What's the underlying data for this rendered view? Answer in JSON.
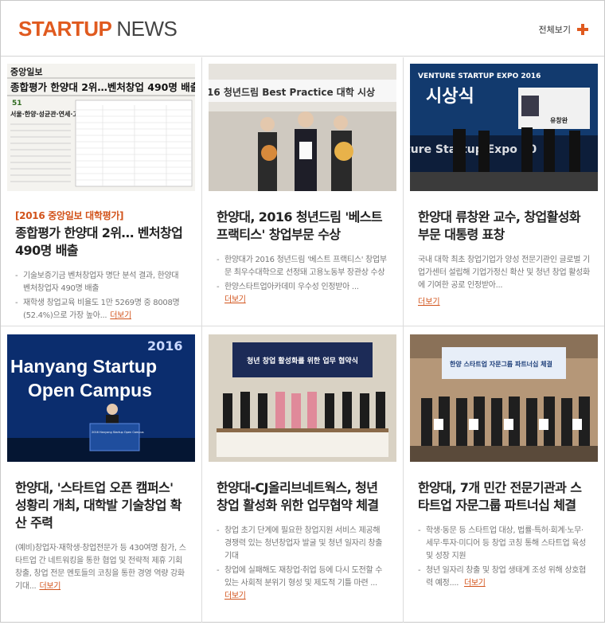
{
  "header": {
    "title_accent": "STARTUP",
    "title_rest": "NEWS",
    "more_label": "전체보기"
  },
  "colors": {
    "accent": "#e05a1f",
    "link": "#d2531b"
  },
  "news": [
    {
      "thumb_text": {
        "masthead": "중앙일보",
        "headline": "종합평가 한양대 2위…벤처창업 490명 배출",
        "subhead": "서울·한양·성균관·연세·고려 순",
        "badge": "51"
      },
      "tag": "[2016 중앙일보 대학평가]",
      "title": "종합평가 한양대 2위… 벤처창업 490명 배출",
      "bullets": [
        "기술보증기금 벤처창업자 명단 분석 결과, 한양대 벤처창업자 490명 배출",
        "재학생 창업교육 비율도 1만 5269명 중 8008명(52.4%)으로 가장 높아..."
      ],
      "more": "더보기"
    },
    {
      "thumb_text": {
        "banner": "16 청년드림 Best Practice 대학 시상"
      },
      "title": "한양대, 2016 청년드림 '베스트 프랙티스' 창업부문 수상",
      "bullets": [
        "한양대가 2016 청년드림 '베스트 프랙티스' 창업부문 최우수대학으로 선정돼 고용노동부 장관상 수상",
        "한양스타트업아카데미 우수성 인정받아 ..."
      ],
      "more": "더보기"
    },
    {
      "thumb_text": {
        "banner_top": "VENTURE STARTUP EXPO 2016",
        "banner_main": "시상식",
        "banner_side": "ture Startup Expo 20",
        "name_card": "유창완"
      },
      "title": "한양대 류창완 교수, 창업활성화 부문 대통령 표창",
      "paragraph": "국내 대학 최초 창업기업가 양성 전문기관인 글로벌 기업가센터 설립해 기업가정신 확산 및 청년 창업 활성화에 기여한 공로 인정받아...",
      "more": "더보기"
    },
    {
      "thumb_text": {
        "year": "2016",
        "line1": "Hanyang Startup",
        "line2": "Open Campus",
        "podium": "2016 Hanyang Startup Open Campus"
      },
      "title": "한양대, '스타트업 오픈 캠퍼스' 성황리 개최, 대학발 기술창업 확산 주력",
      "paragraph": "(예비)창업자·재학생·창업전문가 등 430여명 참가, 스타트업 간 네트워킹을 통한 협업 및 전략적 제휴 기회 창출, 창업 전문 멘토들의 코칭을 통한 경영 역량 강화 기대...",
      "more": "더보기"
    },
    {
      "thumb_text": {
        "banner": "청년 창업 활성화를 위한 업무 협약식"
      },
      "title": "한양대-CJ올리브네트웍스, 청년 창업 활성화 위한 업무협약 체결",
      "bullets": [
        "창업 초기 단계에 필요한 창업지원 서비스 제공해 경쟁력 있는 청년창업자 발굴 및 청년 일자리 창출 기대",
        "창업에 실패해도 재창업·취업 등에 다시 도전할 수 있는 사회적 분위기 형성 및 제도적 기틀 마련 ..."
      ],
      "more": "더보기"
    },
    {
      "thumb_text": {
        "banner": "한양 스타트업 자문그룹 파트너십 체결"
      },
      "title": "한양대, 7개 민간 전문기관과 스타트업 자문그룹 파트너십 체결",
      "bullets": [
        "학생·동문 등 스타트업 대상, 법률·특허·회계·노무·세무·투자·미디어 등 창업 코칭 통해 스타트업 육성 및 성장 지원",
        "청년 일자리 창출 및 창업 생태계 조성 위해 상호협력 예정.... "
      ],
      "more": "더보기"
    }
  ]
}
